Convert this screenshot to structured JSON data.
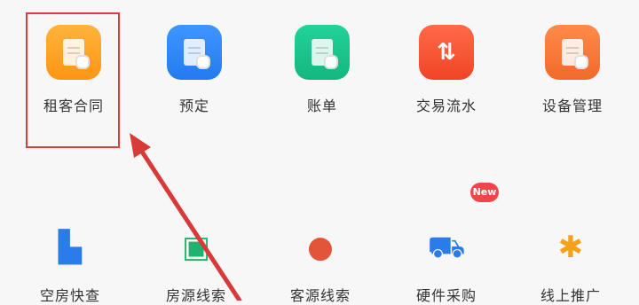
{
  "row1": [
    {
      "label": "租客合同",
      "icon": "contract-icon",
      "color": "#ff9f1f"
    },
    {
      "label": "预定",
      "icon": "calendar-icon",
      "color": "#2a88f5"
    },
    {
      "label": "账单",
      "icon": "bill-icon",
      "color": "#17c48a"
    },
    {
      "label": "交易流水",
      "icon": "transaction-icon",
      "color": "#f24f2f"
    },
    {
      "label": "设备管理",
      "icon": "device-icon",
      "color": "#f57a3a"
    }
  ],
  "row2": [
    {
      "label": "空房快查",
      "icon": "building-icon"
    },
    {
      "label": "房源线索",
      "icon": "listing-icon"
    },
    {
      "label": "客源线索",
      "icon": "customer-icon"
    },
    {
      "label": "硬件采购",
      "icon": "cart-icon"
    },
    {
      "label": "线上推广",
      "icon": "promotion-icon"
    }
  ],
  "badge": "New"
}
